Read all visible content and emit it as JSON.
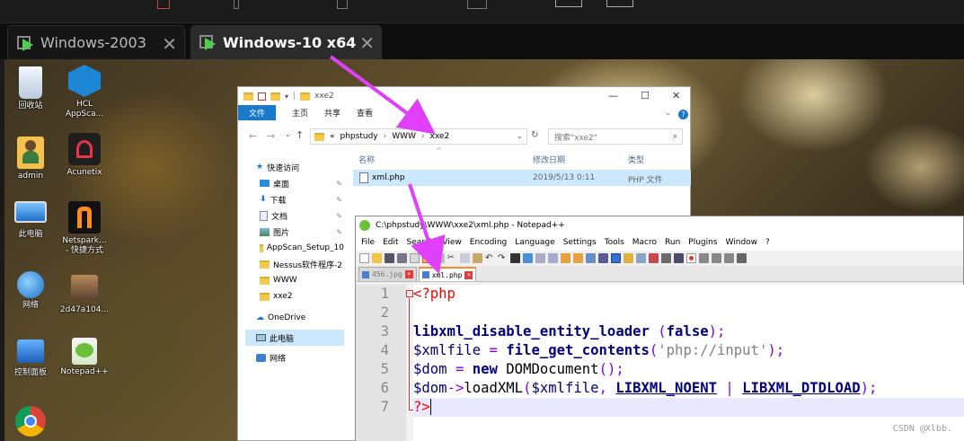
{
  "vm_tabs": [
    {
      "label": "Windows-2003",
      "active": false
    },
    {
      "label": "Windows-10 x64",
      "active": true
    }
  ],
  "desktop": {
    "icons": [
      {
        "label": "回收站"
      },
      {
        "label": "HCL\nAppSca..."
      },
      {
        "label": "admin"
      },
      {
        "label": "Acunetix"
      },
      {
        "label": "此电脑"
      },
      {
        "label": "Netspark...\n- 快捷方式"
      },
      {
        "label": "网络"
      },
      {
        "label": "2d47a104..."
      },
      {
        "label": "控制面板"
      },
      {
        "label": "Notepad++"
      }
    ]
  },
  "explorer": {
    "title": "xxe2",
    "ribbon": {
      "file": "文件",
      "tabs": [
        "主页",
        "共享",
        "查看"
      ]
    },
    "address": {
      "prefix": "«",
      "parts": [
        "phpstudy",
        "WWW",
        "xxe2"
      ]
    },
    "search_placeholder": "搜索\"xxe2\"",
    "nav_items": [
      {
        "label": "快速访问",
        "pinned": false
      },
      {
        "label": "桌面",
        "pinned": true
      },
      {
        "label": "下载",
        "pinned": true
      },
      {
        "label": "文档",
        "pinned": true
      },
      {
        "label": "图片",
        "pinned": true
      },
      {
        "label": "AppScan_Setup_10",
        "pinned": false
      },
      {
        "label": "Nessus软件程序-2",
        "pinned": false
      },
      {
        "label": "WWW",
        "pinned": false
      },
      {
        "label": "xxe2",
        "pinned": false
      },
      {
        "label": "OneDrive",
        "pinned": false
      },
      {
        "label": "此电脑",
        "pinned": false
      },
      {
        "label": "网络",
        "pinned": false
      }
    ],
    "columns": [
      "名称",
      "修改日期",
      "类型"
    ],
    "files": [
      {
        "name": "xml.php",
        "modified": "2019/5/13 0:11",
        "type": "PHP 文件"
      }
    ]
  },
  "notepad": {
    "title": "C:\\phpstudy\\WWW\\xxe2\\xml.php - Notepad++",
    "menu": [
      "File",
      "Edit",
      "Search",
      "View",
      "Encoding",
      "Language",
      "Settings",
      "Tools",
      "Macro",
      "Run",
      "Plugins",
      "Window",
      "?"
    ],
    "tabs": [
      {
        "label": "456.jpg",
        "active": false
      },
      {
        "label": "xml.php",
        "active": true
      }
    ],
    "line_numbers": [
      "1",
      "2",
      "3",
      "4",
      "5",
      "6",
      "7"
    ],
    "code": {
      "l1": "<?php",
      "l3_fn": "libxml_disable_entity_loader",
      "l3_arg": "false",
      "l4_var": "$xmlfile",
      "l4_fn": "file_get_contents",
      "l4_str": "'php://input'",
      "l5_var": "$dom",
      "l5_kw": "new",
      "l5_cls": "DOMDocument",
      "l6_var": "$dom",
      "l6_method": "loadXML",
      "l6_arg": "$xmlfile",
      "l6_c1": "LIBXML_NOENT",
      "l6_c2": "LIBXML_DTDLOAD",
      "l7": "?>"
    }
  },
  "watermark": "CSDN @Xlbb.",
  "colors": {
    "arrow": "#e040fb",
    "vm_play": "#4dcf4a",
    "ribbon_file": "#1979ca",
    "selection": "#cce8ff",
    "tab_accent": "#fa8c2c"
  }
}
